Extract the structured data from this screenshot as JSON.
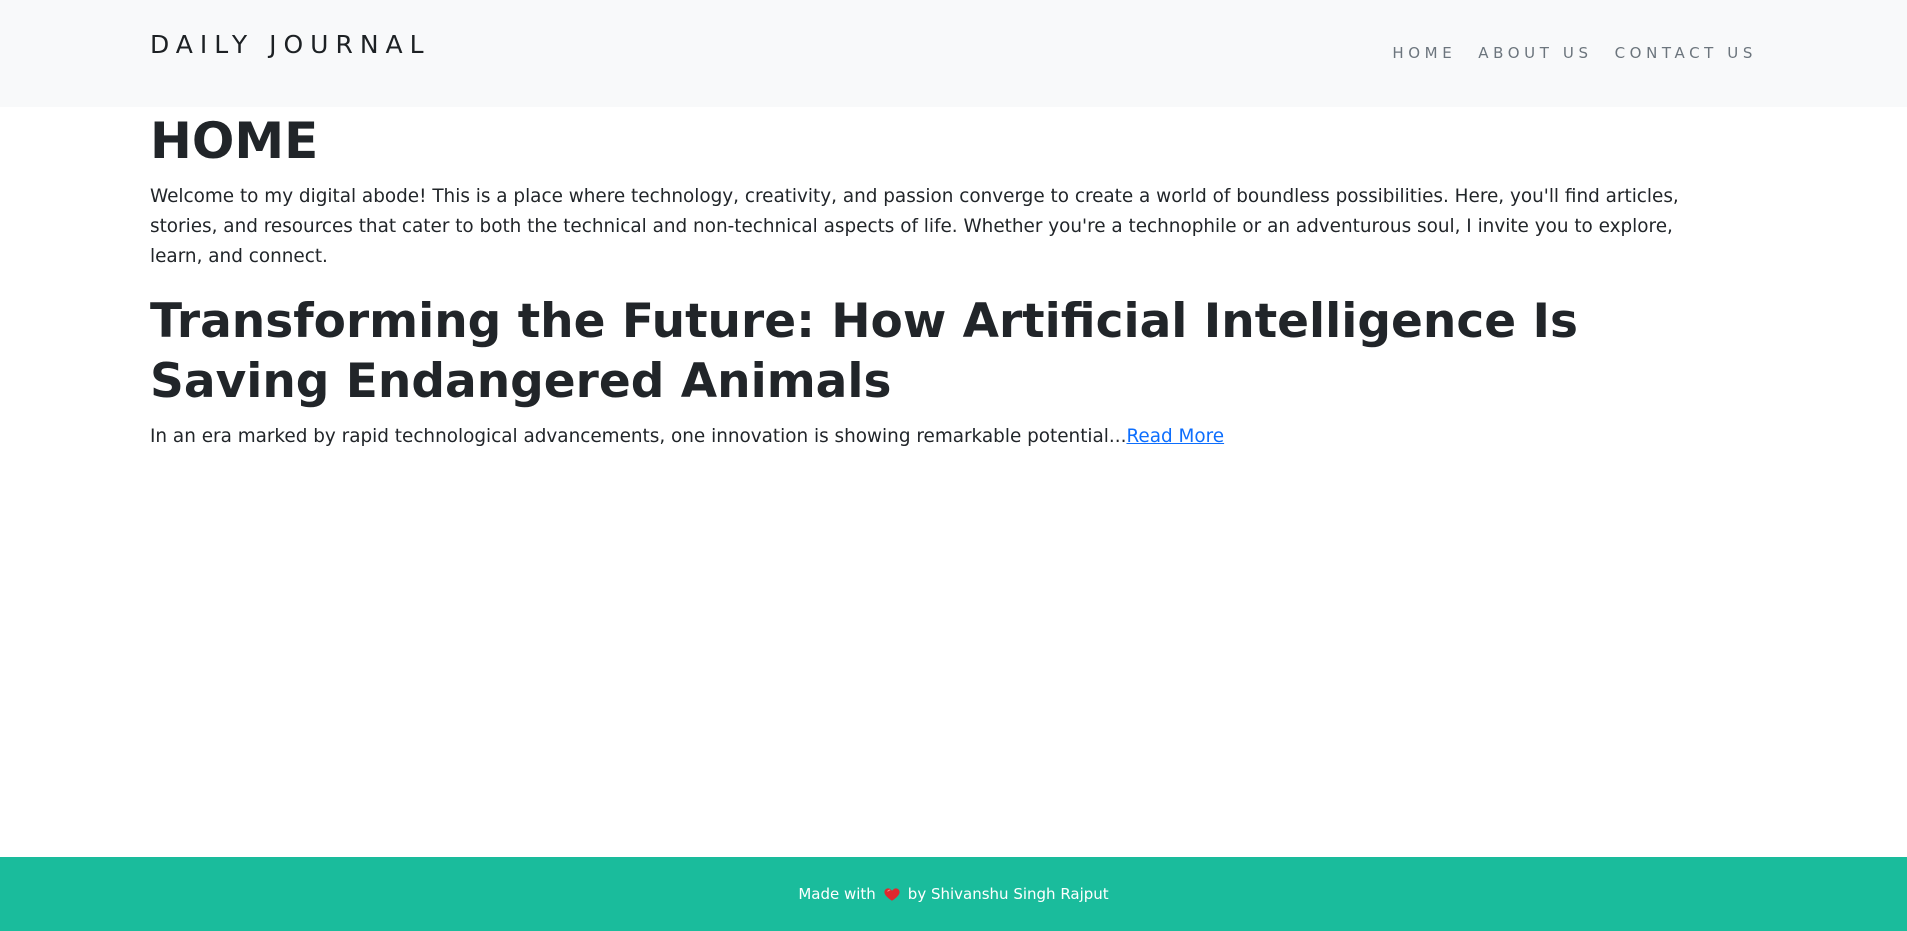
{
  "header": {
    "brand": "DAILY JOURNAL",
    "nav": [
      {
        "label": "HOME"
      },
      {
        "label": "ABOUT US"
      },
      {
        "label": "CONTACT US"
      }
    ]
  },
  "main": {
    "title": "HOME",
    "intro": "Welcome to my digital abode! This is a place where technology, creativity, and passion converge to create a world of boundless possibilities. Here, you'll find articles, stories, and resources that cater to both the technical and non-technical aspects of life. Whether you're a technophile or an adventurous soul, I invite you to explore, learn, and connect.",
    "posts": [
      {
        "title": "Transforming the Future: How Artificial Intelligence Is Saving Endangered Animals",
        "excerpt": "In an era marked by rapid technological advancements, one innovation is showing remarkable potential...",
        "read_more": "Read More"
      }
    ]
  },
  "footer": {
    "prefix": "Made with",
    "icon": "heart-icon",
    "suffix": "by Shivanshu Singh Rajput",
    "background_color": "#1abc9c",
    "heart_color": "#e0282e"
  }
}
